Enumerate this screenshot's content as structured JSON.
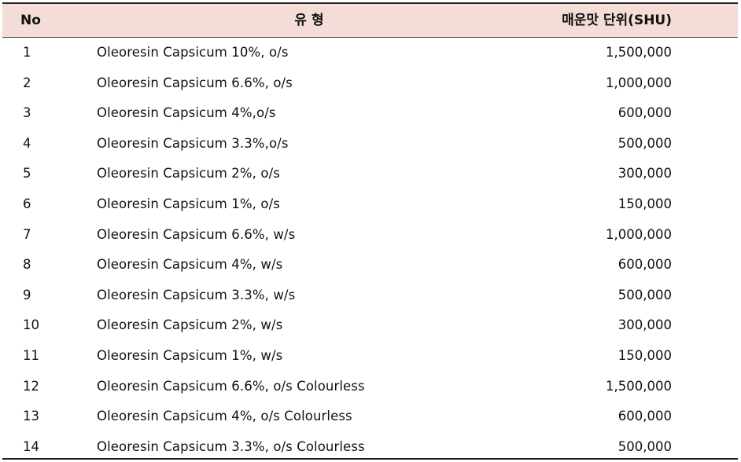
{
  "headers": {
    "no": "No",
    "type": "유 형",
    "shu": "매운맛 단위(SHU)"
  },
  "rows": [
    {
      "no": "1",
      "type": "Oleoresin Capsicum 10%, o/s",
      "shu": "1,500,000"
    },
    {
      "no": "2",
      "type": "Oleoresin Capsicum 6.6%, o/s",
      "shu": "1,000,000"
    },
    {
      "no": "3",
      "type": "Oleoresin Capsicum 4%,o/s",
      "shu": "600,000"
    },
    {
      "no": "4",
      "type": "Oleoresin Capsicum 3.3%,o/s",
      "shu": "500,000"
    },
    {
      "no": "5",
      "type": "Oleoresin Capsicum 2%, o/s",
      "shu": "300,000"
    },
    {
      "no": "6",
      "type": "Oleoresin Capsicum 1%, o/s",
      "shu": "150,000"
    },
    {
      "no": "7",
      "type": "Oleoresin Capsicum 6.6%, w/s",
      "shu": "1,000,000"
    },
    {
      "no": "8",
      "type": "Oleoresin Capsicum 4%, w/s",
      "shu": "600,000"
    },
    {
      "no": "9",
      "type": "Oleoresin Capsicum 3.3%, w/s",
      "shu": "500,000"
    },
    {
      "no": "10",
      "type": "Oleoresin Capsicum 2%, w/s",
      "shu": "300,000"
    },
    {
      "no": "11",
      "type": "Oleoresin Capsicum 1%, w/s",
      "shu": "150,000"
    },
    {
      "no": "12",
      "type": "Oleoresin Capsicum 6.6%, o/s Colourless",
      "shu": "1,500,000"
    },
    {
      "no": "13",
      "type": "Oleoresin Capsicum 4%, o/s Colourless",
      "shu": "600,000"
    },
    {
      "no": "14",
      "type": "Oleoresin Capsicum 3.3%, o/s Colourless",
      "shu": "500,000"
    }
  ],
  "colors": {
    "header_bg": "#f4dcd8",
    "rule": "#222222"
  }
}
